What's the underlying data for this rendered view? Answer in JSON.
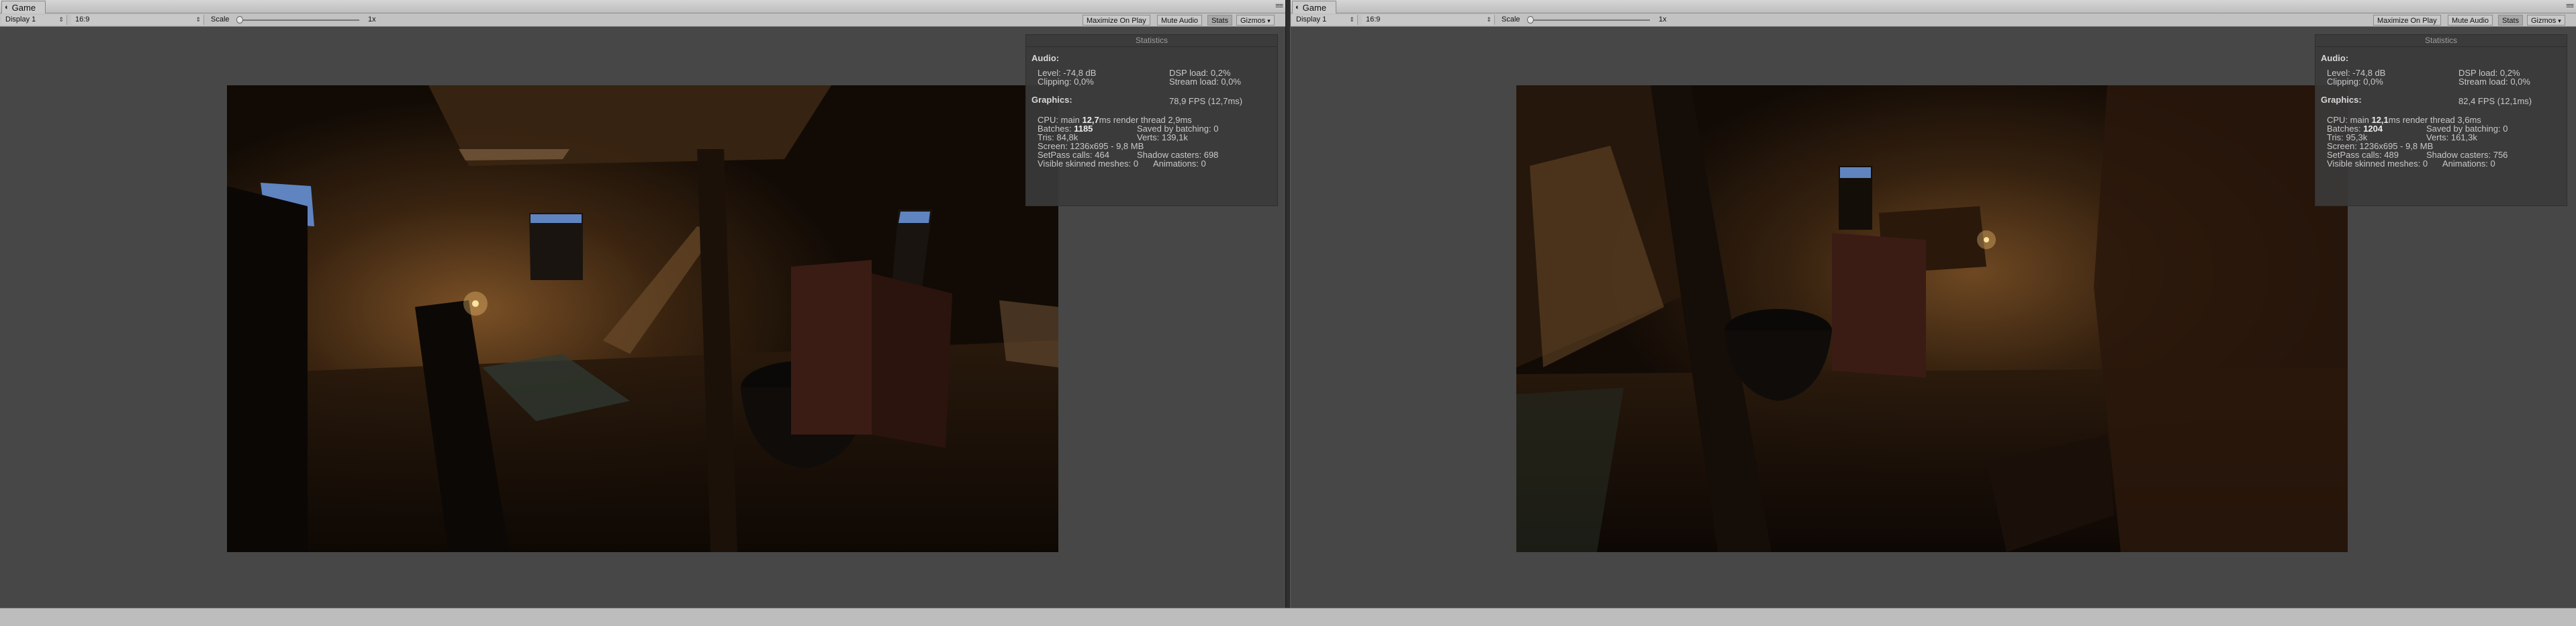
{
  "panels": [
    {
      "tab_label": "Game",
      "toolbar": {
        "display": "Display 1",
        "aspect": "16:9",
        "scale_label": "Scale",
        "scale_value": "1x",
        "maximize_label": "Maximize On Play",
        "mute_label": "Mute Audio",
        "stats_label": "Stats",
        "gizmos_label": "Gizmos"
      },
      "stats": {
        "title": "Statistics",
        "audio_header": "Audio:",
        "level": "Level: -74,8 dB",
        "clipping": "Clipping: 0,0%",
        "dsp_load": "DSP load: 0,2%",
        "stream_load": "Stream load: 0,0%",
        "graphics_header": "Graphics:",
        "fps": "78,9 FPS (12,7ms)",
        "cpu_prefix": "CPU: main ",
        "cpu_main": "12,7",
        "cpu_suffix": "ms  render thread 2,9ms",
        "batches_prefix": "Batches: ",
        "batches": "1185",
        "saved_batching": "Saved by batching: 0",
        "tris": "Tris: 84,8k",
        "verts": "Verts: 139,1k",
        "screen": "Screen: 1236x695 - 9,8 MB",
        "setpass": "SetPass calls: 464",
        "shadow_casters": "Shadow casters: 698",
        "skinned": "Visible skinned meshes: 0",
        "animations": "Animations: 0"
      }
    },
    {
      "tab_label": "Game",
      "toolbar": {
        "display": "Display 1",
        "aspect": "16:9",
        "scale_label": "Scale",
        "scale_value": "1x",
        "maximize_label": "Maximize On Play",
        "mute_label": "Mute Audio",
        "stats_label": "Stats",
        "gizmos_label": "Gizmos"
      },
      "stats": {
        "title": "Statistics",
        "audio_header": "Audio:",
        "level": "Level: -74,8 dB",
        "clipping": "Clipping: 0,0%",
        "dsp_load": "DSP load: 0,2%",
        "stream_load": "Stream load: 0,0%",
        "graphics_header": "Graphics:",
        "fps": "82,4 FPS (12,1ms)",
        "cpu_prefix": "CPU: main ",
        "cpu_main": "12,1",
        "cpu_suffix": "ms  render thread 3,6ms",
        "batches_prefix": "Batches: ",
        "batches": "1204",
        "saved_batching": "Saved by batching: 0",
        "tris": "Tris: 95,3k",
        "verts": "Verts: 161,3k",
        "screen": "Screen: 1236x695 - 9,8 MB",
        "setpass": "SetPass calls: 489",
        "shadow_casters": "Shadow casters: 756",
        "skinned": "Visible skinned meshes: 0",
        "animations": "Animations: 0"
      }
    }
  ],
  "colors": {
    "panel_bg": "#474747",
    "stats_bg": "#3a3a3a",
    "toggle_active": "#a9a9a9"
  },
  "icons": {
    "tab": "unity-logo-icon",
    "window_menu": "window-menu-icon",
    "dropdown": "chevron-down-icon"
  }
}
